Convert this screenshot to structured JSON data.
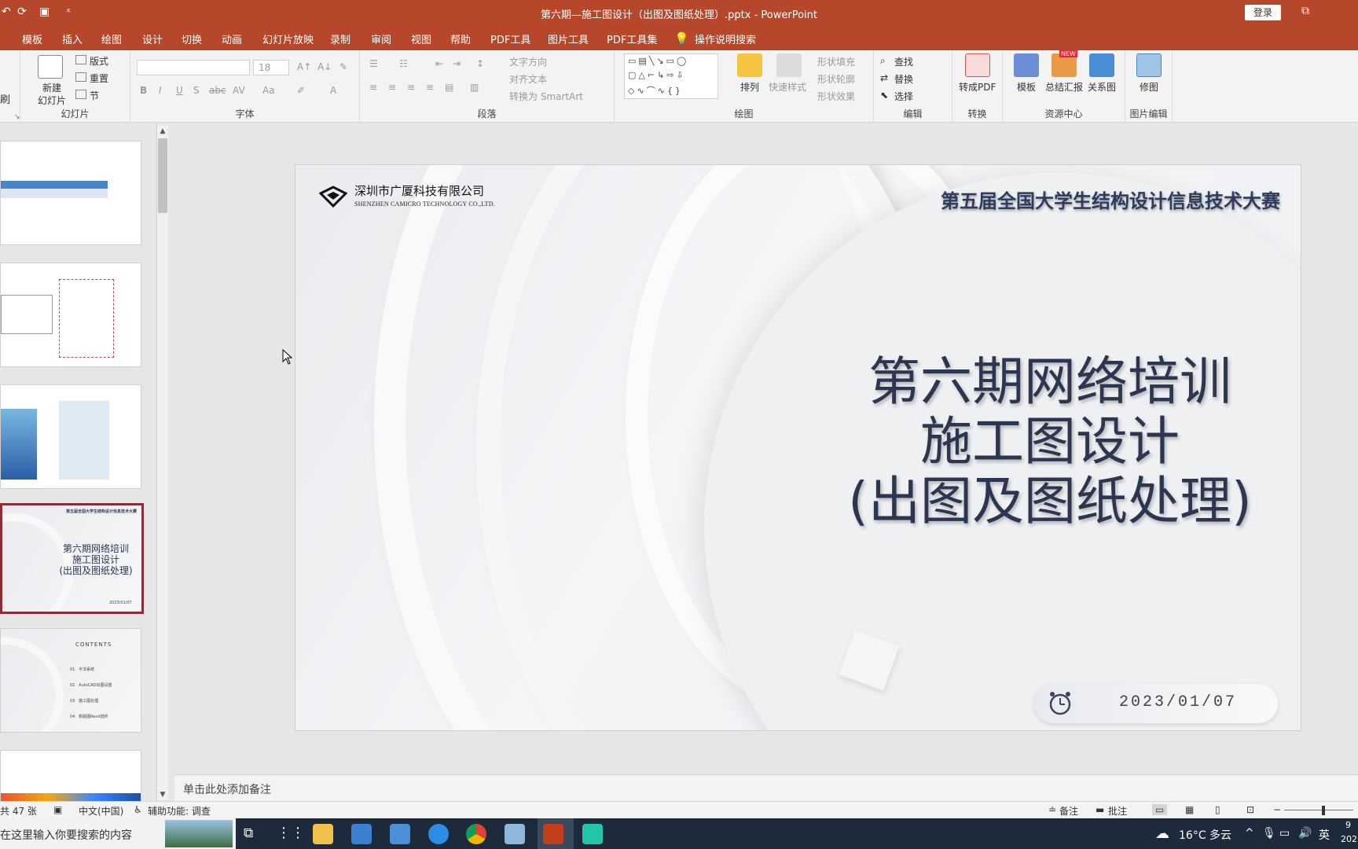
{
  "window": {
    "title": "第六期—施工图设计（出图及图纸处理）.pptx  -  PowerPoint",
    "login_label": "登录"
  },
  "tabs": [
    "模板",
    "插入",
    "绘图",
    "设计",
    "切换",
    "动画",
    "幻灯片放映",
    "录制",
    "审阅",
    "视图",
    "帮助",
    "PDF工具",
    "图片工具",
    "PDF工具集"
  ],
  "tell_me": "操作说明搜索",
  "ribbon": {
    "slides": {
      "new_slide": "新建\n幻灯片",
      "layout": "版式",
      "reset": "重置",
      "section": "节",
      "label": "幻灯片",
      "clipboard_fragment": "刷"
    },
    "font": {
      "font_size": "18",
      "label": "字体"
    },
    "paragraph": {
      "text_direction": "文字方向",
      "align_text": "对齐文本",
      "convert_smartart": "转换为 SmartArt",
      "label": "段落"
    },
    "drawing": {
      "arrange": "排列",
      "quick_styles": "快速样式",
      "shape_fill": "形状填充",
      "shape_outline": "形状轮廓",
      "shape_effects": "形状效果",
      "label": "绘图"
    },
    "editing": {
      "find": "查找",
      "replace": "替换",
      "select": "选择",
      "label": "编辑"
    },
    "convert": {
      "to_pdf": "转成PDF",
      "label": "转换"
    },
    "resources": {
      "template": "模板",
      "summary": "总结汇报",
      "relation": "关系图",
      "new_badge": "NEW",
      "label": "资源中心"
    },
    "picture_edit": {
      "retouch": "修图",
      "label": "图片编辑"
    }
  },
  "thumbnails": {
    "thumb4": {
      "header": "第五届全国大学生结构设计信息技术大赛",
      "title_lines": [
        "第六期网络培训",
        "施工图设计",
        "(出图及图纸处理)"
      ],
      "date": "2023/01/07"
    },
    "thumb5": {
      "heading": "CONTENTS",
      "items": [
        {
          "num": "01",
          "text": "平法系统"
        },
        {
          "num": "02",
          "text": "AutoCAD出图设置"
        },
        {
          "num": "03",
          "text": "施工图处理"
        },
        {
          "num": "04",
          "text": "新版图Revit插件"
        }
      ]
    }
  },
  "slide": {
    "company_cn": "深圳市广厦科技有限公司",
    "company_en": "SHENZHEN CAMICRO TECHNOLOGY CO.,LTD.",
    "contest": "第五届全国大学生结构设计信息技术大赛",
    "title_lines": [
      "第六期网络培训",
      "施工图设计",
      "(出图及图纸处理)"
    ],
    "date": "2023/01/07"
  },
  "notes_placeholder": "单击此处添加备注",
  "status": {
    "slide_count": "共 47 张",
    "language": "中文(中国)",
    "accessibility": "辅助功能: 调查",
    "notes": "备注",
    "comments": "批注"
  },
  "taskbar": {
    "search_text": "在这里输入你要搜索的内容",
    "weather": "16°C 多云",
    "ime": "英",
    "clock_fragment_1": "9",
    "clock_fragment_2": "202"
  },
  "colors": {
    "accent": "#b7472a",
    "selected_thumb": "#8b2c36",
    "title_text": "#2c3651"
  }
}
